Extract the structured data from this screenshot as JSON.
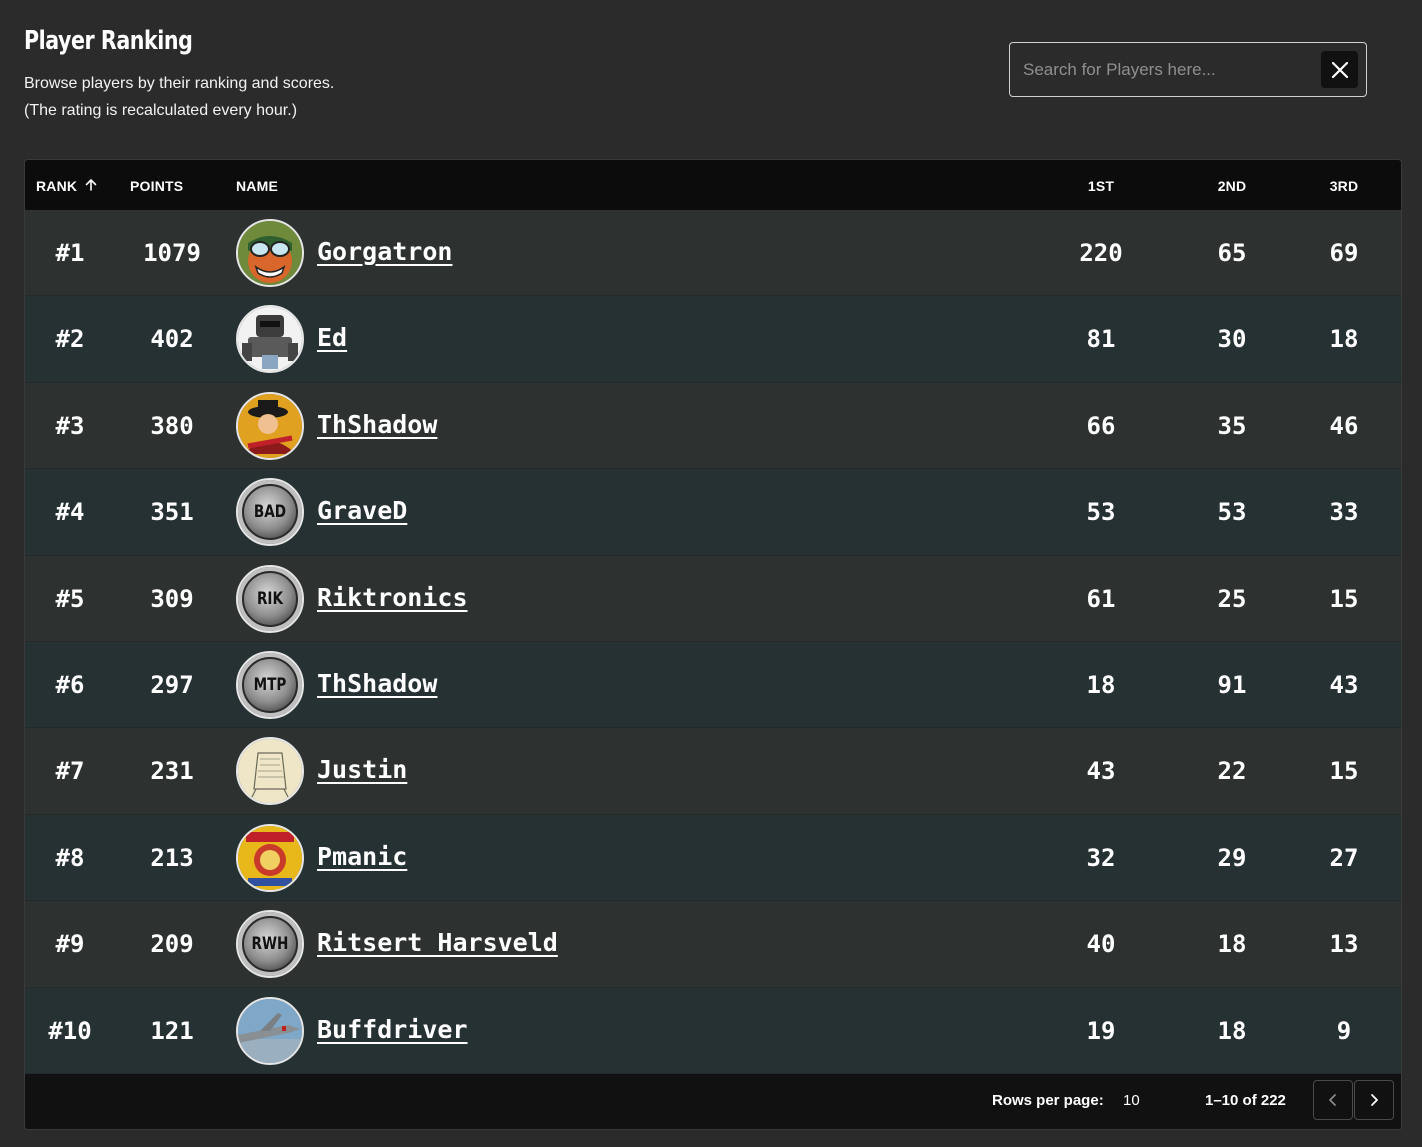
{
  "header": {
    "title": "Player Ranking",
    "subtitle_line1": "Browse players by their ranking and scores.",
    "subtitle_line2": "(The rating is recalculated every hour.)"
  },
  "search": {
    "placeholder": "Search for Players here...",
    "value": "",
    "clear_icon": "close-icon"
  },
  "table": {
    "columns": {
      "rank": "RANK",
      "points": "POINTS",
      "name": "NAME",
      "first": "1ST",
      "second": "2ND",
      "third": "3RD"
    },
    "sort_icon": "arrow-up-icon",
    "rows": [
      {
        "rank": "#1",
        "points": "1079",
        "name": "Gorgatron",
        "first": "220",
        "second": "65",
        "third": "69",
        "avatar": "goggles-face"
      },
      {
        "rank": "#2",
        "points": "402",
        "name": "Ed",
        "first": "81",
        "second": "30",
        "third": "18",
        "avatar": "robot"
      },
      {
        "rank": "#3",
        "points": "380",
        "name": "ThShadow",
        "first": "66",
        "second": "35",
        "third": "46",
        "avatar": "shadow-knows"
      },
      {
        "rank": "#4",
        "points": "351",
        "name": "GraveD",
        "first": "53",
        "second": "53",
        "third": "33",
        "avatar": "initials",
        "initials": "BAD"
      },
      {
        "rank": "#5",
        "points": "309",
        "name": "Riktronics",
        "first": "61",
        "second": "25",
        "third": "15",
        "avatar": "initials",
        "initials": "RIK"
      },
      {
        "rank": "#6",
        "points": "297",
        "name": "ThShadow",
        "first": "18",
        "second": "91",
        "third": "43",
        "avatar": "initials",
        "initials": "MTP"
      },
      {
        "rank": "#7",
        "points": "231",
        "name": "Justin",
        "first": "43",
        "second": "22",
        "third": "15",
        "avatar": "sketch"
      },
      {
        "rank": "#8",
        "points": "213",
        "name": "Pmanic",
        "first": "32",
        "second": "29",
        "third": "27",
        "avatar": "beer"
      },
      {
        "rank": "#9",
        "points": "209",
        "name": "Ritsert Harsveld",
        "first": "40",
        "second": "18",
        "third": "13",
        "avatar": "initials",
        "initials": "RWH"
      },
      {
        "rank": "#10",
        "points": "121",
        "name": "Buffdriver",
        "first": "19",
        "second": "18",
        "third": "9",
        "avatar": "aircraft"
      }
    ]
  },
  "footer": {
    "rows_per_page_label": "Rows per page:",
    "rows_per_page_value": "10",
    "range": "1–10 of 222",
    "prev_icon": "chevron-left-icon",
    "next_icon": "chevron-right-icon"
  },
  "colors": {
    "background": "#2b2b2b",
    "row_odd": "#2d3230",
    "row_even": "#263134",
    "header_bg": "#0c0c0c"
  }
}
